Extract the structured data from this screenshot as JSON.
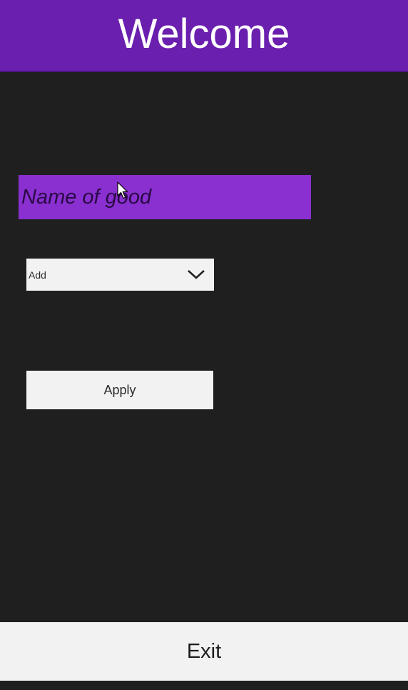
{
  "header": {
    "title": "Welcome"
  },
  "form": {
    "name_field": {
      "value": "",
      "placeholder": "Name of good"
    },
    "action_select": {
      "selected": "Add"
    },
    "apply_label": "Apply"
  },
  "footer": {
    "exit_label": "Exit"
  },
  "icons": {
    "dropdown": "chevron-down-icon",
    "pointer": "mouse-cursor-icon"
  },
  "colors": {
    "header_bg": "#6a1fae",
    "field_bg": "#8a2fd0",
    "page_bg": "#1f1f1f",
    "button_bg": "#f2f2f2"
  }
}
